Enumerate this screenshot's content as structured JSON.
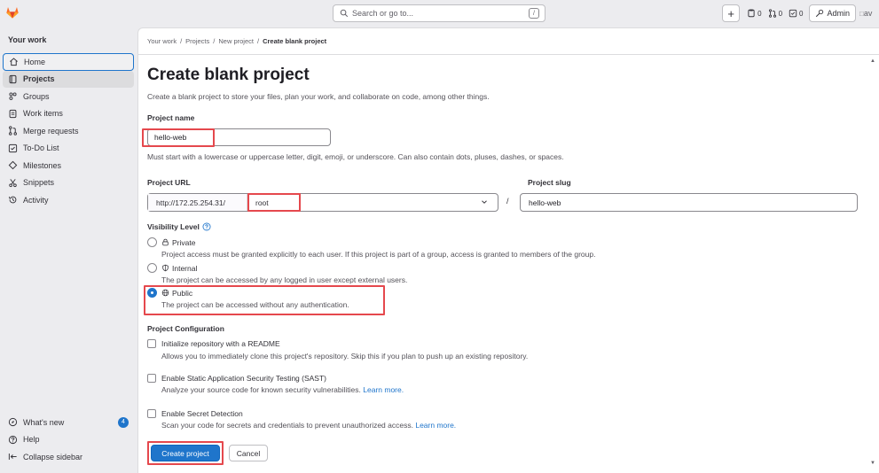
{
  "search": {
    "placeholder": "Search or go to...",
    "shortcut": "/"
  },
  "topbar": {
    "issues_count": "0",
    "mr_count": "0",
    "todo_count": "0",
    "admin_label": "Admin",
    "avatar_alt": "av"
  },
  "sidebar": {
    "section_title": "Your work",
    "items": [
      {
        "label": "Home",
        "icon": "home-icon"
      },
      {
        "label": "Projects",
        "icon": "project-icon"
      },
      {
        "label": "Groups",
        "icon": "group-icon"
      },
      {
        "label": "Work items",
        "icon": "work-items-icon"
      },
      {
        "label": "Merge requests",
        "icon": "merge-request-icon"
      },
      {
        "label": "To-Do List",
        "icon": "todo-icon"
      },
      {
        "label": "Milestones",
        "icon": "milestone-icon"
      },
      {
        "label": "Snippets",
        "icon": "snippet-icon"
      },
      {
        "label": "Activity",
        "icon": "history-icon"
      }
    ],
    "whats_new": "What's new",
    "whats_new_count": "4",
    "help": "Help",
    "collapse": "Collapse sidebar"
  },
  "breadcrumb": [
    "Your work",
    "/",
    "Projects",
    "/",
    "New project",
    "/",
    "Create blank project"
  ],
  "page": {
    "title": "Create blank project",
    "description": "Create a blank project to store your files, plan your work, and collaborate on code, among other things."
  },
  "form": {
    "project_name_label": "Project name",
    "project_name_value": "hello-web",
    "project_name_help": "Must start with a lowercase or uppercase letter, digit, emoji, or underscore. Can also contain dots, pluses, dashes, or spaces.",
    "project_url_label": "Project URL",
    "url_prefix": "http://172.25.254.31/",
    "namespace": "root",
    "slash": "/",
    "project_slug_label": "Project slug",
    "project_slug_value": "hello-web",
    "visibility_label": "Visibility Level",
    "visibility": [
      {
        "label": "Private",
        "help": "Project access must be granted explicitly to each user. If this project is part of a group, access is granted to members of the group."
      },
      {
        "label": "Internal",
        "help": "The project can be accessed by any logged in user except external users."
      },
      {
        "label": "Public",
        "help": "The project can be accessed without any authentication."
      }
    ],
    "selected_visibility": "Public",
    "config_label": "Project Configuration",
    "config": [
      {
        "label": "Initialize repository with a README",
        "help": "Allows you to immediately clone this project's repository. Skip this if you plan to push up an existing repository.",
        "link": ""
      },
      {
        "label": "Enable Static Application Security Testing (SAST)",
        "help": "Analyze your source code for known security vulnerabilities.",
        "link": "Learn more."
      },
      {
        "label": "Enable Secret Detection",
        "help": "Scan your code for secrets and credentials to prevent unauthorized access.",
        "link": "Learn more."
      }
    ],
    "create_button": "Create project",
    "cancel_button": "Cancel"
  },
  "colors": {
    "primary": "#1f75cb",
    "highlight": "#e5484d",
    "logo": "#e24329"
  }
}
